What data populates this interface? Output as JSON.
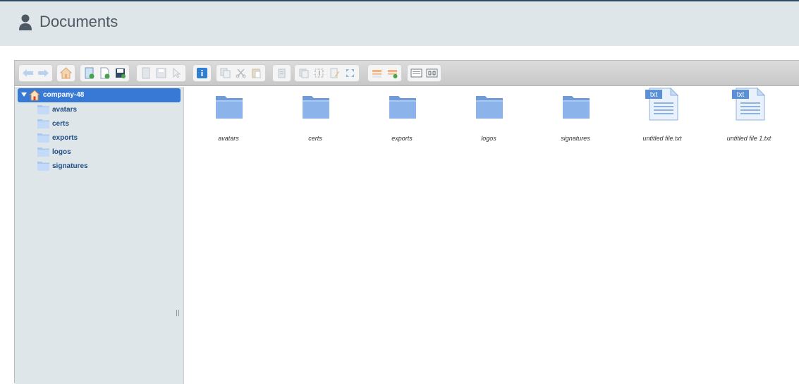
{
  "header": {
    "title": "Documents",
    "icon": "user-icon"
  },
  "toolbar": {
    "groups": [
      [
        "back-icon",
        "forward-icon"
      ],
      [
        "home-icon"
      ],
      [
        "reload-icon",
        "new-file-icon",
        "save-icon"
      ],
      [
        "open-icon",
        "save-disk-icon",
        "select-icon"
      ],
      [
        "info-icon"
      ],
      [
        "copy-icon",
        "cut-icon",
        "paste-icon"
      ],
      [
        "delete-icon"
      ],
      [
        "duplicate-icon",
        "rename-icon",
        "edit-icon",
        "resize-icon"
      ],
      [
        "extract-icon",
        "archive-icon"
      ],
      [
        "view-icon",
        "sort-icon"
      ]
    ]
  },
  "tree": {
    "root": "company-48",
    "items": [
      "avatars",
      "certs",
      "exports",
      "logos",
      "signatures"
    ]
  },
  "files": [
    {
      "name": "avatars",
      "type": "folder"
    },
    {
      "name": "certs",
      "type": "folder"
    },
    {
      "name": "exports",
      "type": "folder"
    },
    {
      "name": "logos",
      "type": "folder"
    },
    {
      "name": "signatures",
      "type": "folder"
    },
    {
      "name": "untitled file.txt",
      "type": "txt",
      "badge": "txt"
    },
    {
      "name": "untitled file 1.txt",
      "type": "txt",
      "badge": "txt"
    }
  ],
  "colors": {
    "accent": "#3779d4",
    "header_bg": "#dfe6ea",
    "folder": "#7fa8e4"
  }
}
